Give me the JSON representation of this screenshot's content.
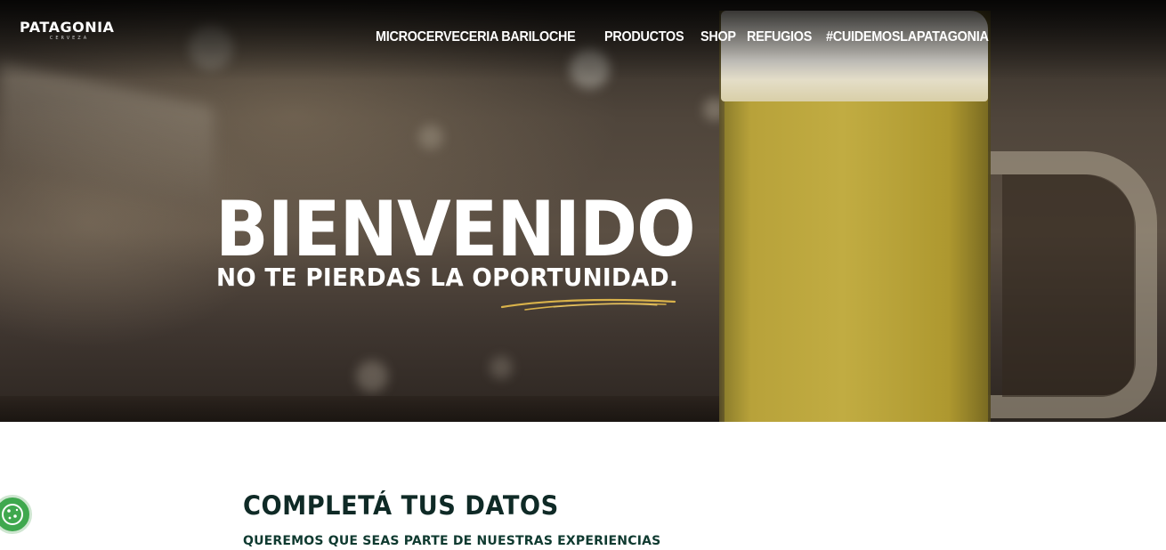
{
  "header": {
    "logo_text": "PATAGONIA",
    "logo_subtext": "CERVEZA",
    "nav": [
      {
        "label": "MICROCERVECERIA BARILOCHE"
      },
      {
        "label": "PRODUCTOS"
      },
      {
        "label": "SHOP"
      },
      {
        "label": "REFUGIOS"
      },
      {
        "label": "#CUIDEMOSLAPATAGONIA"
      }
    ]
  },
  "hero": {
    "title": "BIENVENIDO",
    "subtitle": "NO TE PIERDAS LA  OPORTUNIDAD."
  },
  "form": {
    "title": "COMPLETÁ TUS DATOS",
    "subtitle": "QUEREMOS QUE SEAS PARTE DE NUESTRAS EXPERIENCIAS"
  },
  "icons": {
    "cookie": "cookie-icon",
    "swoosh": "underline-swoosh"
  },
  "colors": {
    "heading_dark_green": "#0f2a26",
    "cookie_green": "#3fa84e",
    "swoosh_gold": "#d9b24a"
  }
}
